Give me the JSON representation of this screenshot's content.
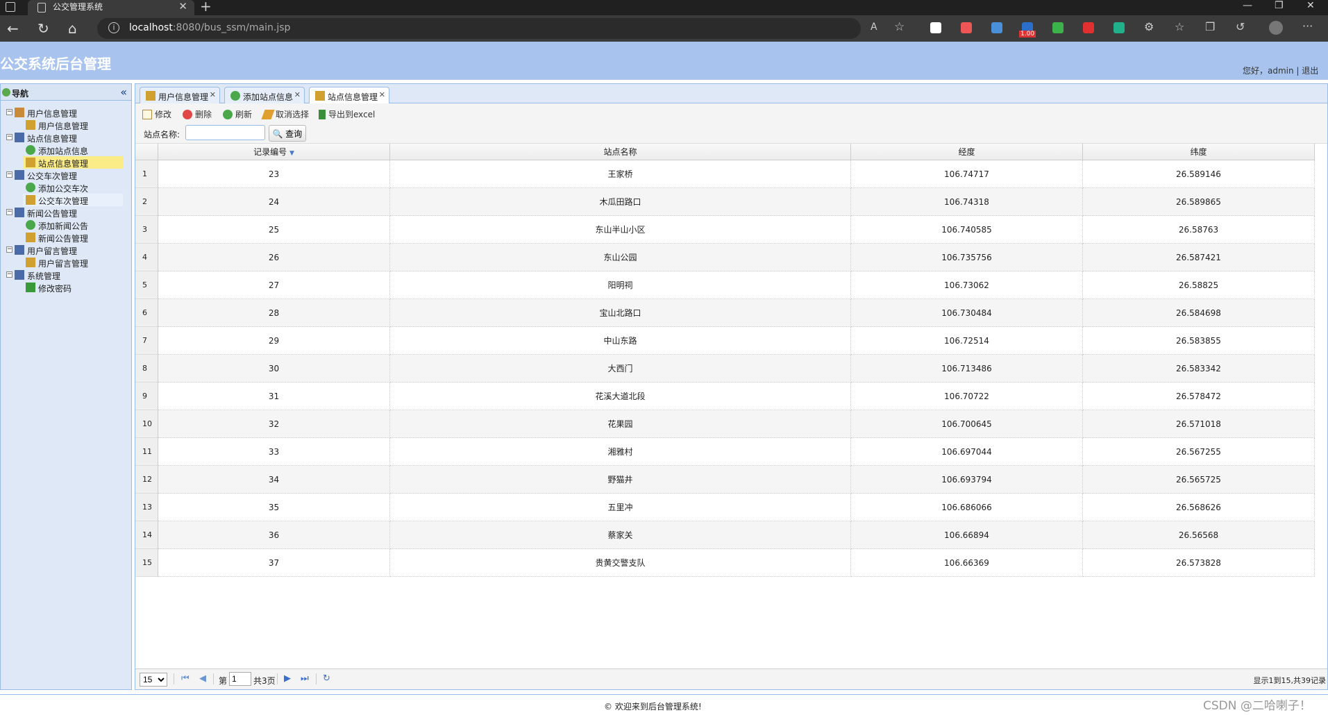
{
  "browser": {
    "tab_title": "公交管理系统",
    "url_host": "localhost",
    "url_path": ":8080/bus_ssm/main.jsp",
    "ext_badge": "1.00"
  },
  "app": {
    "title": "公交系统后台管理",
    "user_info": "您好，admin | 退出",
    "footer": "© 欢迎来到后台管理系统!",
    "watermark": "CSDN @二哈喇子！"
  },
  "nav": {
    "title": "导航",
    "items": [
      {
        "label": "用户信息管理",
        "level": 0,
        "icon": "users-folder-icon"
      },
      {
        "label": "用户信息管理",
        "level": 1,
        "icon": "users-icon"
      },
      {
        "label": "站点信息管理",
        "level": 0,
        "icon": "monitor-icon"
      },
      {
        "label": "添加站点信息",
        "level": 1,
        "icon": "add-icon"
      },
      {
        "label": "站点信息管理",
        "level": 1,
        "icon": "users-icon",
        "selected": true
      },
      {
        "label": "公交车次管理",
        "level": 0,
        "icon": "monitor-icon"
      },
      {
        "label": "添加公交车次",
        "level": 1,
        "icon": "add-icon"
      },
      {
        "label": "公交车次管理",
        "level": 1,
        "icon": "users-icon",
        "hover": true
      },
      {
        "label": "新闻公告管理",
        "level": 0,
        "icon": "monitor-icon"
      },
      {
        "label": "添加新闻公告",
        "level": 1,
        "icon": "add-icon"
      },
      {
        "label": "新闻公告管理",
        "level": 1,
        "icon": "users-icon"
      },
      {
        "label": "用户留言管理",
        "level": 0,
        "icon": "monitor-icon"
      },
      {
        "label": "用户留言管理",
        "level": 1,
        "icon": "users-icon"
      },
      {
        "label": "系统管理",
        "level": 0,
        "icon": "monitor-icon"
      },
      {
        "label": "修改密码",
        "level": 1,
        "icon": "pencil-icon"
      }
    ]
  },
  "tabs": [
    {
      "label": "用户信息管理",
      "icon": "users-icon"
    },
    {
      "label": "添加站点信息",
      "icon": "add-icon"
    },
    {
      "label": "站点信息管理",
      "icon": "users-icon",
      "active": true
    }
  ],
  "toolbar": {
    "edit": "修改",
    "delete": "删除",
    "refresh": "刷新",
    "unselect": "取消选择",
    "export": "导出到excel"
  },
  "search": {
    "label": "站点名称:",
    "value": "",
    "button": "查询"
  },
  "grid": {
    "columns": [
      "记录编号",
      "站点名称",
      "经度",
      "纬度"
    ],
    "rows": [
      [
        "1",
        "23",
        "王家桥",
        "106.74717",
        "26.589146"
      ],
      [
        "2",
        "24",
        "木瓜田路口",
        "106.74318",
        "26.589865"
      ],
      [
        "3",
        "25",
        "东山半山小区",
        "106.740585",
        "26.58763"
      ],
      [
        "4",
        "26",
        "东山公园",
        "106.735756",
        "26.587421"
      ],
      [
        "5",
        "27",
        "阳明祠",
        "106.73062",
        "26.58825"
      ],
      [
        "6",
        "28",
        "宝山北路口",
        "106.730484",
        "26.584698"
      ],
      [
        "7",
        "29",
        "中山东路",
        "106.72514",
        "26.583855"
      ],
      [
        "8",
        "30",
        "大西门",
        "106.713486",
        "26.583342"
      ],
      [
        "9",
        "31",
        "花溪大道北段",
        "106.70722",
        "26.578472"
      ],
      [
        "10",
        "32",
        "花果园",
        "106.700645",
        "26.571018"
      ],
      [
        "11",
        "33",
        "湘雅村",
        "106.697044",
        "26.567255"
      ],
      [
        "12",
        "34",
        "野猫井",
        "106.693794",
        "26.565725"
      ],
      [
        "13",
        "35",
        "五里冲",
        "106.686066",
        "26.568626"
      ],
      [
        "14",
        "36",
        "蔡家关",
        "106.66894",
        "26.56568"
      ],
      [
        "15",
        "37",
        "贵黄交警支队",
        "106.66369",
        "26.573828"
      ]
    ]
  },
  "pager": {
    "page_size": "15",
    "page_prefix": "第",
    "current_page": "1",
    "total_pages": "共3页",
    "info": "显示1到15,共39记录"
  }
}
